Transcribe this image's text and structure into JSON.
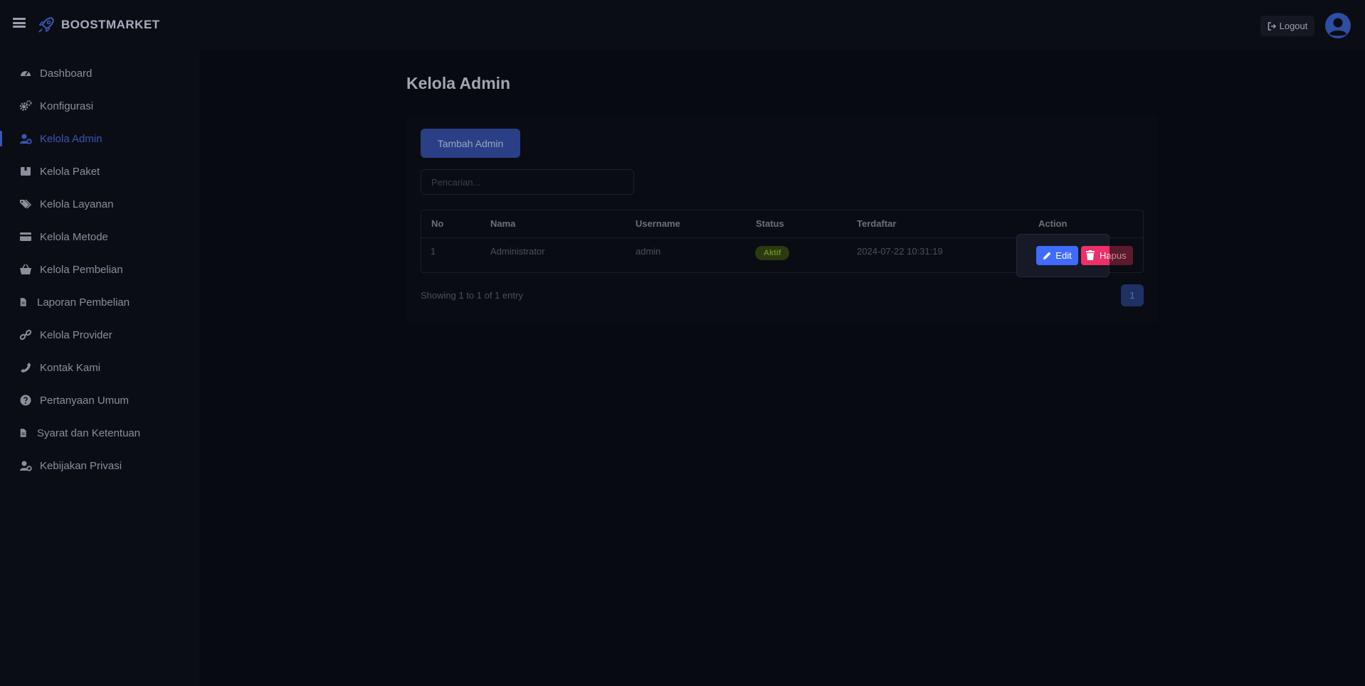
{
  "app": {
    "brand_name": "BOOSTMARKET",
    "logout_label": "Logout"
  },
  "sidebar": {
    "items": [
      {
        "label": "Dashboard",
        "icon": "dashboard-icon"
      },
      {
        "label": "Konfigurasi",
        "icon": "cogs-icon"
      },
      {
        "label": "Kelola Admin",
        "icon": "user-cog-icon",
        "active": true
      },
      {
        "label": "Kelola Paket",
        "icon": "box-icon"
      },
      {
        "label": "Kelola Layanan",
        "icon": "tags-icon"
      },
      {
        "label": "Kelola Metode",
        "icon": "credit-card-icon"
      },
      {
        "label": "Kelola Pembelian",
        "icon": "basket-icon"
      },
      {
        "label": "Laporan Pembelian",
        "icon": "file-icon"
      },
      {
        "label": "Kelola Provider",
        "icon": "link-icon"
      },
      {
        "label": "Kontak Kami",
        "icon": "phone-icon"
      },
      {
        "label": "Pertanyaan Umum",
        "icon": "question-circle-icon"
      },
      {
        "label": "Syarat dan Ketentuan",
        "icon": "file-icon"
      },
      {
        "label": "Kebijakan Privasi",
        "icon": "user-cog-icon"
      }
    ]
  },
  "main": {
    "page_title": "Kelola Admin",
    "add_button_label": "Tambah Admin",
    "search_placeholder": "Pencarian...",
    "table": {
      "headers": {
        "no": "No",
        "nama": "Nama",
        "username": "Username",
        "status": "Status",
        "terdaftar": "Terdaftar",
        "action": "Action"
      },
      "rows": [
        {
          "no": "1",
          "nama": "Administrator",
          "username": "admin",
          "status": "Aktif",
          "terdaftar": "2024-07-22 10:31:19",
          "edit_label": "Edit",
          "delete_label": "Hapus"
        }
      ]
    },
    "showing_text": "Showing 1 to 1 of 1 entry",
    "pagination": {
      "current": "1"
    }
  },
  "colors": {
    "accent": "#3a57b3",
    "edit": "#3f6bff",
    "delete": "#ee2f6a",
    "status_active": "#6f8a25"
  }
}
